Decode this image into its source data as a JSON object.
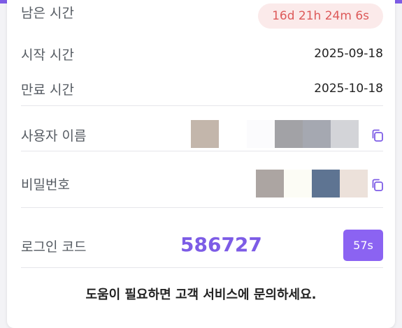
{
  "remaining": {
    "label": "남은 시간",
    "value": "16d 21h 24m 6s"
  },
  "start": {
    "label": "시작 시간",
    "value": "2025-09-18"
  },
  "end": {
    "label": "만료 시간",
    "value": "2025-10-18"
  },
  "username": {
    "label": "사용자 이름",
    "pixel_colors": [
      "#c3b6ab",
      "#ffffff",
      "#fbfbfd",
      "#a2a2a6",
      "#a5a8b1",
      "#d3d4d8"
    ],
    "copy_icon": "copy-icon"
  },
  "password": {
    "label": "비밀번호",
    "pixel_colors": [
      "#aca5a2",
      "#fcfcf5",
      "#5e7492",
      "#ece1da"
    ],
    "copy_icon": "copy-icon"
  },
  "login_code": {
    "label": "로그인 코드",
    "code": "586727",
    "countdown": "57s"
  },
  "help": {
    "text": "도움이 필요하면 고객 서비스에 문의하세요."
  },
  "colors": {
    "accent": "#7d5ce6",
    "timer_bg": "#fbeaea",
    "timer_text": "#dd5a5a",
    "countdown_bg": "#8b63f2"
  }
}
